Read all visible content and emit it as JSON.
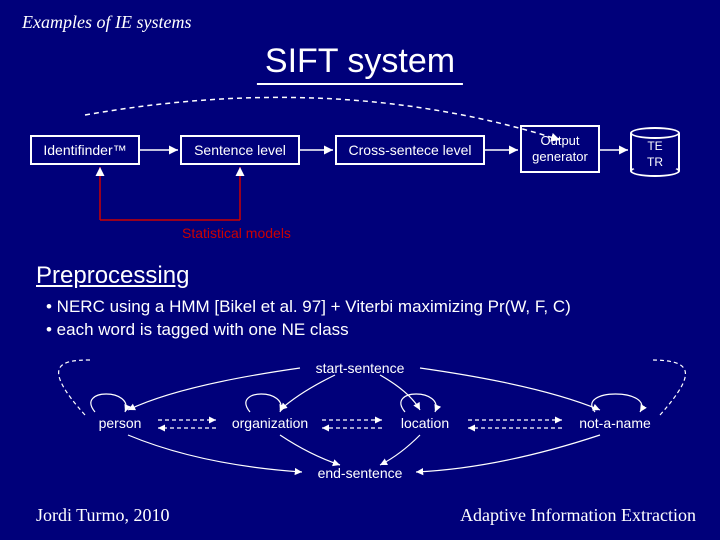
{
  "header": {
    "section": "Examples of IE systems"
  },
  "title": "SIFT system",
  "pipeline": {
    "identifinder": "Identifinder™",
    "sentence": "Sentence level",
    "cross": "Cross-sentece level",
    "output": "Output generator",
    "db": {
      "line1": "TE",
      "line2": "TR"
    },
    "stat_models": "Statistical models"
  },
  "preprocessing": {
    "heading": "Preprocessing",
    "bullet1": "• NERC using a HMM [Bikel et al. 97] + Viterbi maximizing Pr(W, F, C)",
    "bullet2": "• each word is tagged with one NE class"
  },
  "hmm": {
    "start": "start-sentence",
    "end": "end-sentence",
    "person": "person",
    "organization": "organization",
    "location": "location",
    "not_a_name": "not-a-name"
  },
  "footer": {
    "author": "Jordi Turmo, 2010",
    "course": "Adaptive Information Extraction"
  }
}
